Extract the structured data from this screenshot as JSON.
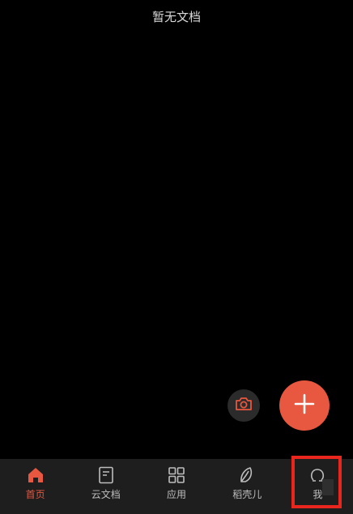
{
  "empty_state": {
    "title": "暂无文档"
  },
  "actions": {
    "camera_icon": "camera-icon",
    "add_icon": "plus-icon"
  },
  "tabbar": {
    "items": [
      {
        "label": "首页",
        "icon": "home-icon",
        "active": true
      },
      {
        "label": "云文档",
        "icon": "document-icon",
        "active": false
      },
      {
        "label": "应用",
        "icon": "grid-icon",
        "active": false
      },
      {
        "label": "稻壳儿",
        "icon": "leaf-icon",
        "active": false
      },
      {
        "label": "我",
        "icon": "profile-icon",
        "active": false
      }
    ]
  },
  "colors": {
    "accent": "#e8573f",
    "highlight": "#e8261e",
    "background": "#000000",
    "tabbar_bg": "#1e1e1e"
  }
}
